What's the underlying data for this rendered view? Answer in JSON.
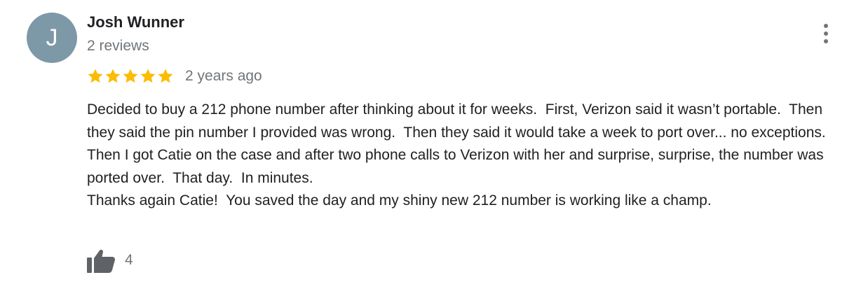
{
  "review": {
    "author": {
      "initial": "J",
      "name": "Josh Wunner",
      "meta": "2 reviews",
      "avatar_color": "#7d98a6"
    },
    "rating": 5,
    "star_color": "#fbbc04",
    "date": "2 years ago",
    "paragraphs": [
      "Decided to buy a 212 phone number after thinking about it for weeks.  First, Verizon said it wasn’t portable.  Then they said the pin number I provided was wrong.  Then they said it would take a week to port over... no exceptions.",
      "Then I got Catie on the case and after two phone calls to Verizon with her and surprise, surprise, the number was ported over.  That day.  In minutes.",
      "Thanks again Catie!  You saved the day and my shiny new 212 number is working like a champ."
    ],
    "likes": "4",
    "icons": {
      "more": "more-vert-icon",
      "like": "thumb-up-icon",
      "star": "star-icon"
    }
  }
}
